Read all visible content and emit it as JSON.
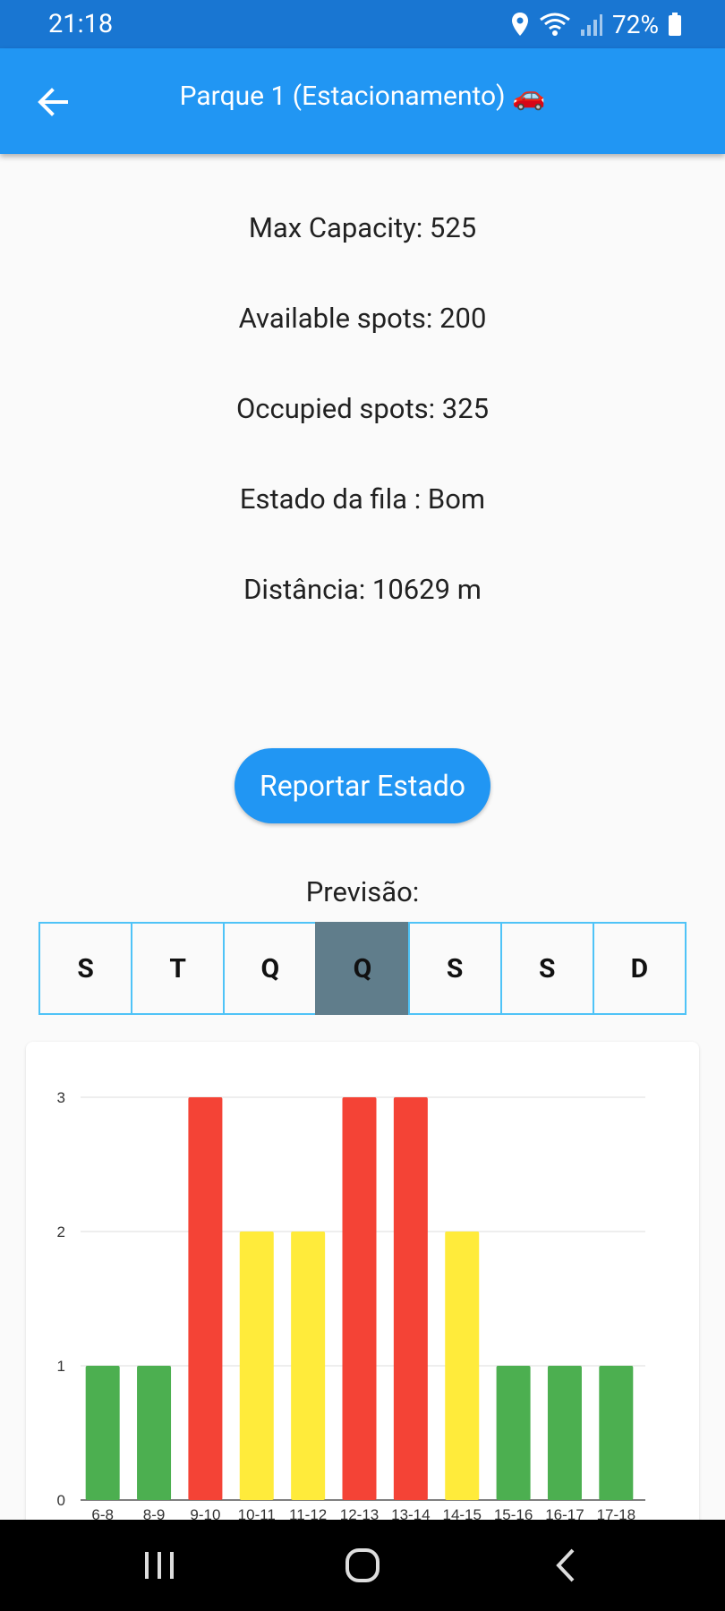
{
  "status_bar": {
    "time": "21:18",
    "battery_percent": "72%",
    "icons": [
      "location-icon",
      "wifi-icon",
      "signal-icon",
      "battery-icon"
    ]
  },
  "app_bar": {
    "title": "Parque 1 (Estacionamento) 🚗",
    "back_icon": "arrow-back-icon"
  },
  "info": {
    "max_capacity": "Max Capacity: 525",
    "available_spots": "Available spots: 200",
    "occupied_spots": "Occupied spots: 325",
    "queue_state": "Estado da fila : Bom",
    "distance": "Distância: 10629 m"
  },
  "report_button_label": "Reportar Estado",
  "forecast": {
    "label": "Previsão:",
    "days": [
      "S",
      "T",
      "Q",
      "Q",
      "S",
      "S",
      "D"
    ],
    "selected_index": 3
  },
  "chart_data": {
    "type": "bar",
    "categories": [
      "6-8",
      "8-9",
      "9-10",
      "10-11",
      "11-12",
      "12-13",
      "13-14",
      "14-15",
      "15-16",
      "16-17",
      "17-18"
    ],
    "values": [
      1,
      1,
      3,
      2,
      2,
      3,
      3,
      2,
      1,
      1,
      1
    ],
    "ylim": [
      0,
      3
    ],
    "yticks": [
      "0",
      "1",
      "2",
      "3"
    ],
    "grid": true,
    "colors": {
      "1": "#4caf50",
      "2": "#ffeb3b",
      "3": "#f44336"
    }
  },
  "nav_bar": {
    "buttons": [
      "recent-apps-icon",
      "home-icon",
      "back-nav-icon"
    ]
  }
}
